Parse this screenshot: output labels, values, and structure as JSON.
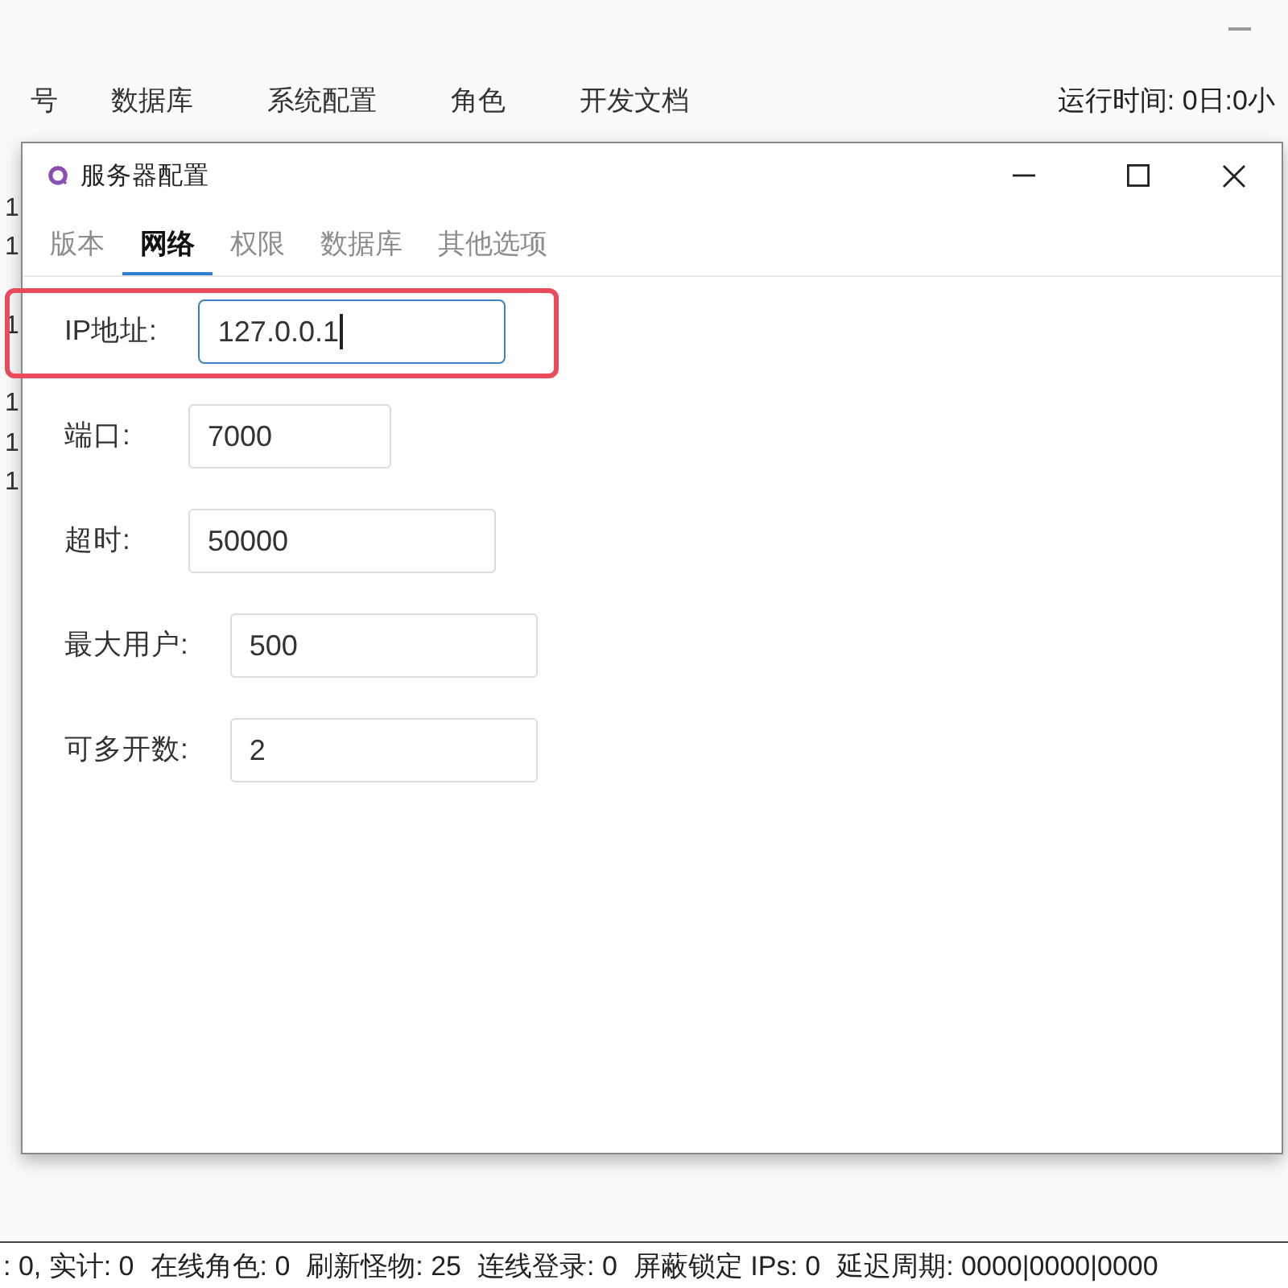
{
  "main_window": {
    "menu": [
      {
        "label": "号"
      },
      {
        "label": "数据库"
      },
      {
        "label": "系统配置"
      },
      {
        "label": "角色"
      },
      {
        "label": "开发文档"
      }
    ],
    "runtime": "运行时间: 0日:0小"
  },
  "log_lines": [
    "1",
    "1",
    "1",
    "1",
    "1",
    "1"
  ],
  "dialog": {
    "title": "服务器配置",
    "tabs": [
      {
        "label": "版本",
        "selected": false
      },
      {
        "label": "网络",
        "selected": true
      },
      {
        "label": "权限",
        "selected": false
      },
      {
        "label": "数据库",
        "selected": false
      },
      {
        "label": "其他选项",
        "selected": false
      }
    ],
    "fields": [
      {
        "label": "IP地址:",
        "value": "127.0.0.1",
        "focused": true,
        "annotated": true
      },
      {
        "label": "端口:",
        "value": "7000",
        "focused": false,
        "annotated": false
      },
      {
        "label": "超时:",
        "value": "50000",
        "focused": false,
        "annotated": false
      },
      {
        "label": "最大用户:",
        "value": "500",
        "focused": false,
        "annotated": false
      },
      {
        "label": "可多开数:",
        "value": "2",
        "focused": false,
        "annotated": false
      }
    ]
  },
  "status_bar": [
    ": 0, 实计: 0",
    "在线角色: 0",
    "刷新怪物: 25",
    "连线登录: 0",
    "屏蔽锁定 IPs: 0",
    "延迟周期: 0000|0000|0000"
  ]
}
